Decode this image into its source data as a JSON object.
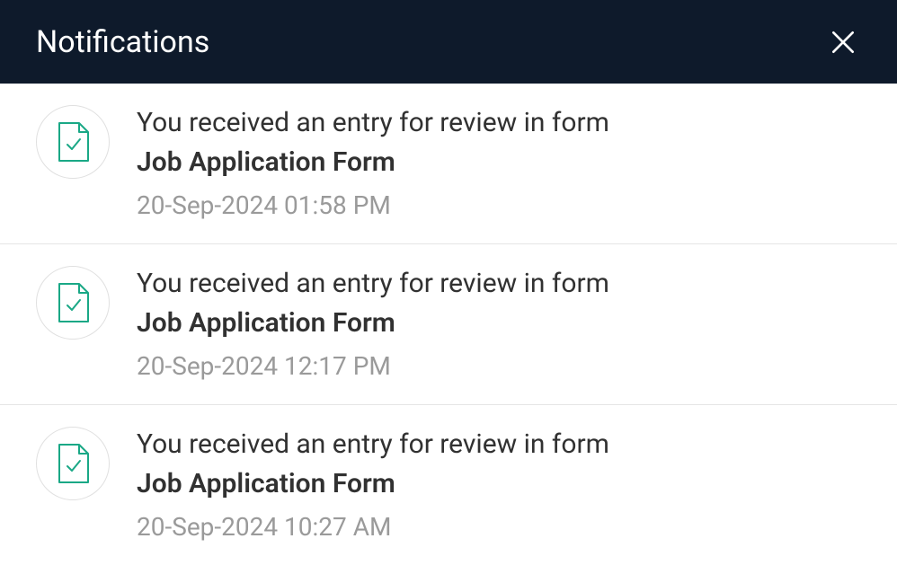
{
  "header": {
    "title": "Notifications"
  },
  "notifications": [
    {
      "message": "You received an entry for review in form",
      "form": "Job Application Form",
      "timestamp": "20-Sep-2024 01:58 PM"
    },
    {
      "message": "You received an entry for review in form",
      "form": "Job Application Form",
      "timestamp": "20-Sep-2024 12:17 PM"
    },
    {
      "message": "You received an entry for review in form",
      "form": "Job Application Form",
      "timestamp": "20-Sep-2024 10:27 AM"
    }
  ]
}
